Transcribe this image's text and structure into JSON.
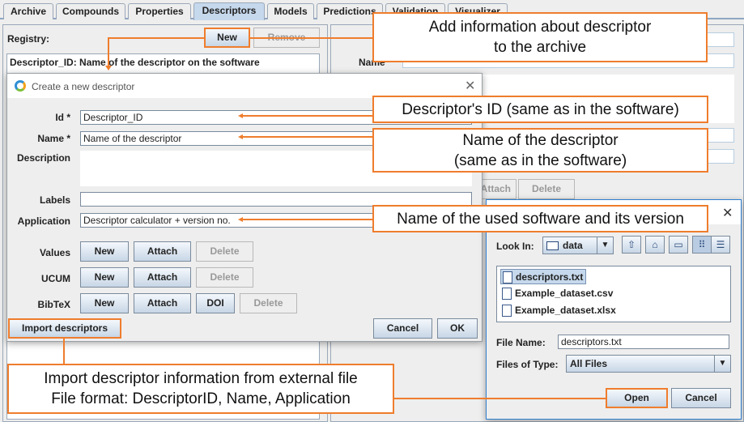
{
  "tabs": [
    {
      "label": "Archive",
      "active": false
    },
    {
      "label": "Compounds",
      "active": false
    },
    {
      "label": "Properties",
      "active": false
    },
    {
      "label": "Descriptors",
      "active": true
    },
    {
      "label": "Models",
      "active": false
    },
    {
      "label": "Predictions",
      "active": false
    },
    {
      "label": "Validation",
      "active": false
    },
    {
      "label": "Visualizer",
      "active": false
    }
  ],
  "registry": {
    "label": "Registry:",
    "new_label": "New",
    "remove_label": "Remove",
    "selected_item": "Descriptor_ID: Name of the descriptor on the software"
  },
  "right_panel": {
    "name_label": "Name",
    "attach_label": "Attach",
    "delete_label": "Delete"
  },
  "create_dialog": {
    "title": "Create a new descriptor",
    "id_label": "Id *",
    "id_value": "Descriptor_ID",
    "name_label": "Name *",
    "name_value": "Name of the descriptor",
    "description_label": "Description",
    "description_value": "",
    "labels_label": "Labels",
    "labels_value": "",
    "application_label": "Application",
    "application_value": "Descriptor calculator + version no.",
    "values_label": "Values",
    "ucum_label": "UCUM",
    "bibtex_label": "BibTeX",
    "new_label": "New",
    "attach_label": "Attach",
    "delete_label": "Delete",
    "doi_label": "DOI",
    "import_label": "Import descriptors",
    "cancel_label": "Cancel",
    "ok_label": "OK"
  },
  "file_dialog": {
    "look_in_label": "Look In:",
    "look_in_value": "data",
    "files": [
      {
        "name": "descriptors.txt",
        "selected": true
      },
      {
        "name": "Example_dataset.csv",
        "selected": false
      },
      {
        "name": "Example_dataset.xlsx",
        "selected": false
      }
    ],
    "file_name_label": "File Name:",
    "file_name_value": "descriptors.txt",
    "files_of_type_label": "Files of Type:",
    "files_of_type_value": "All Files",
    "open_label": "Open",
    "cancel_label": "Cancel"
  },
  "callouts": {
    "new": [
      "Add information about descriptor",
      "to the archive"
    ],
    "id": "Descriptor's ID (same as in the software)",
    "name": [
      "Name of the descriptor",
      "(same as in the software)"
    ],
    "application": "Name of the used software and its version",
    "import": [
      "Import descriptor information from external file",
      "File format: DescriptorID, Name, Application"
    ]
  },
  "colors": {
    "accent": "#ef7d2d",
    "active_tab": "#c6d8ec"
  }
}
